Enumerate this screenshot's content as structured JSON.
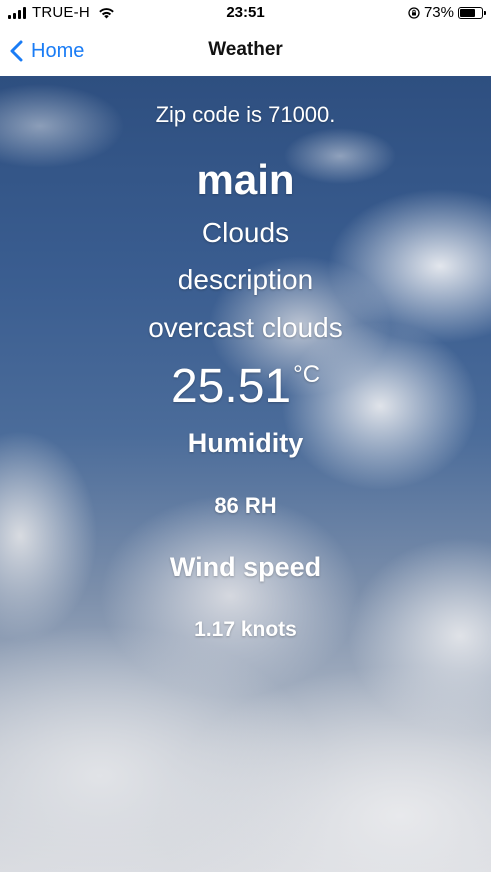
{
  "status_bar": {
    "carrier": "TRUE-H",
    "time": "23:51",
    "battery_percent": "73%",
    "battery_level": 0.73,
    "icons": [
      "signal-icon",
      "wifi-icon",
      "orientation-lock-icon",
      "battery-icon"
    ]
  },
  "nav": {
    "back_label": "Home",
    "title": "Weather",
    "accent_color": "#1a7cf5"
  },
  "weather": {
    "zip_text": "Zip code is 71000.",
    "main_label": "main",
    "main_value": "Clouds",
    "description_label": "description",
    "description_value": "overcast clouds",
    "temperature": "25.51",
    "temperature_unit": "°C",
    "humidity_label": "Humidity",
    "humidity_value": "86 RH",
    "wind_label": "Wind speed",
    "wind_value": "1.17 knots"
  }
}
